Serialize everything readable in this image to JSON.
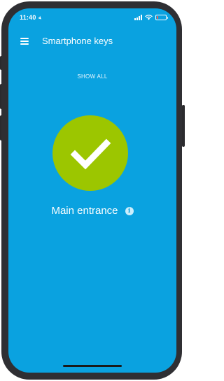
{
  "status_bar": {
    "time": "11:40",
    "location_icon": "location-arrow-icon",
    "signal_icon": "cellular-signal-icon",
    "wifi_icon": "wifi-icon",
    "battery_icon": "battery-low-icon",
    "battery_level": 0.2
  },
  "header": {
    "menu_icon": "hamburger-menu-icon",
    "title": "Smartphone keys"
  },
  "show_all_label": "SHOW ALL",
  "key": {
    "status_icon": "checkmark-icon",
    "door_name": "Main entrance",
    "info_icon": "info-icon",
    "info_glyph": "i"
  },
  "colors": {
    "background": "#0aa2e0",
    "success": "#9cc600",
    "text": "#ffffff",
    "battery_low": "#ff5a4e"
  }
}
